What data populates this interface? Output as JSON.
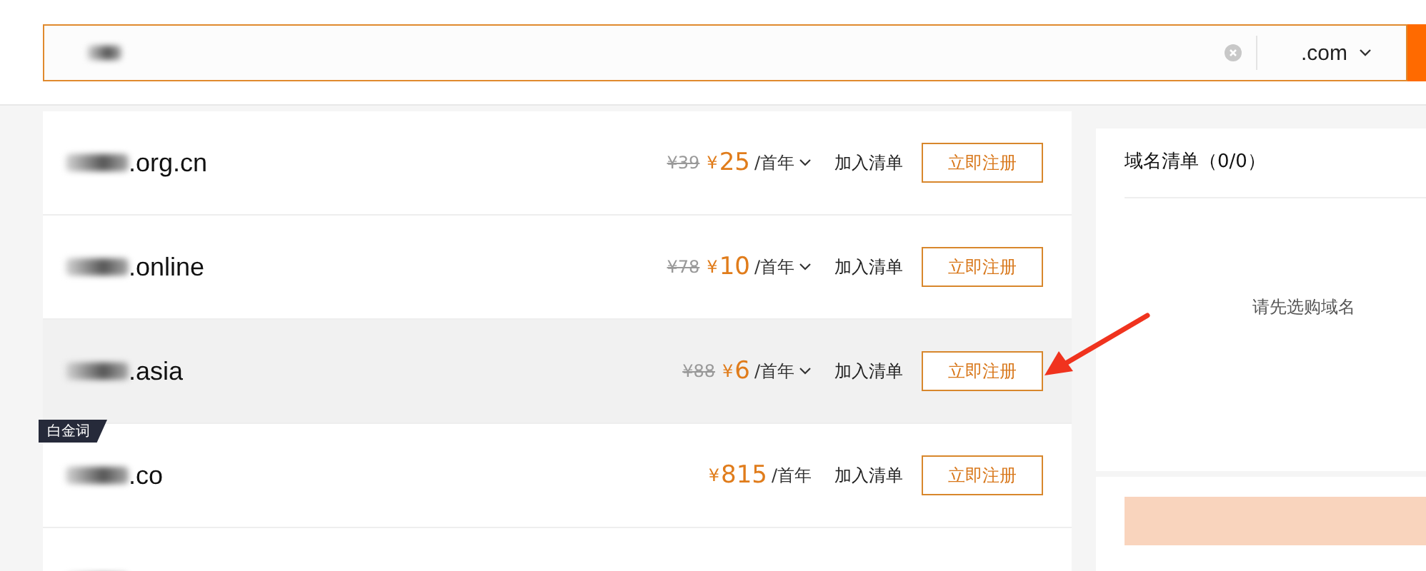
{
  "search": {
    "suffix": ".com"
  },
  "domains": [
    {
      "suffix": ".org.cn",
      "original_price": "¥39",
      "currency": "¥",
      "price": "25",
      "period": "/首年",
      "expandable": true,
      "highlighted": false,
      "add_label": "加入清单",
      "register_label": "立即注册"
    },
    {
      "suffix": ".online",
      "original_price": "¥78",
      "currency": "¥",
      "price": "10",
      "period": "/首年",
      "expandable": true,
      "highlighted": false,
      "add_label": "加入清单",
      "register_label": "立即注册"
    },
    {
      "suffix": ".asia",
      "original_price": "¥88",
      "currency": "¥",
      "price": "6",
      "period": "/首年",
      "expandable": true,
      "highlighted": true,
      "add_label": "加入清单",
      "register_label": "立即注册"
    },
    {
      "suffix": ".co",
      "badge": "白金词",
      "currency": "¥",
      "price": "815",
      "period": "/首年",
      "expandable": false,
      "highlighted": false,
      "add_label": "加入清单",
      "register_label": "立即注册"
    }
  ],
  "cart": {
    "title": "域名清单（0/0）",
    "empty_text": "请先选购域名"
  }
}
